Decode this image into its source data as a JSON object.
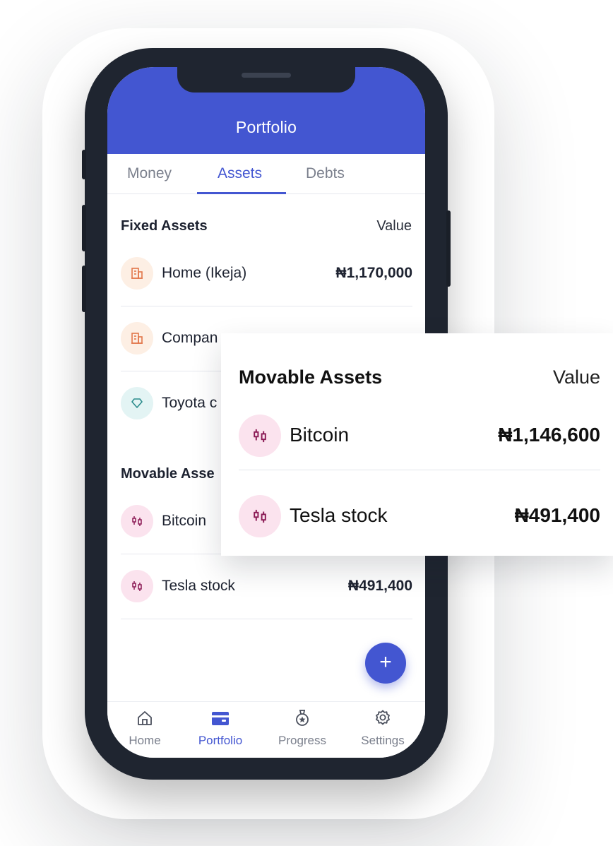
{
  "app": {
    "title": "Portfolio"
  },
  "tabs": [
    {
      "label": "Money"
    },
    {
      "label": "Assets"
    },
    {
      "label": "Debts"
    }
  ],
  "fixed_assets": {
    "heading": "Fixed Assets",
    "value_label": "Value",
    "items": [
      {
        "label": "Home (Ikeja)",
        "amount": "₦1,170,000",
        "icon": "building-icon"
      },
      {
        "label": "Compan",
        "amount": "",
        "icon": "building-icon"
      },
      {
        "label": "Toyota c",
        "amount": "",
        "icon": "diamond-icon"
      }
    ]
  },
  "movable_assets": {
    "heading": "Movable Asse",
    "items": [
      {
        "label": "Bitcoin",
        "amount": "",
        "icon": "candlestick-icon"
      },
      {
        "label": "Tesla stock",
        "amount": "₦491,400",
        "icon": "candlestick-icon"
      }
    ]
  },
  "fab": {
    "label": "+"
  },
  "bottom_nav": [
    {
      "label": "Home",
      "icon": "home-icon"
    },
    {
      "label": "Portfolio",
      "icon": "wallet-icon"
    },
    {
      "label": "Progress",
      "icon": "medal-icon"
    },
    {
      "label": "Settings",
      "icon": "gear-icon"
    }
  ],
  "popup_card": {
    "heading": "Movable Assets",
    "value_label": "Value",
    "items": [
      {
        "label": "Bitcoin",
        "amount": "₦1,146,600"
      },
      {
        "label": "Tesla stock",
        "amount": "₦491,400"
      }
    ]
  },
  "colors": {
    "accent": "#4356d1",
    "frame": "#1f2530"
  }
}
